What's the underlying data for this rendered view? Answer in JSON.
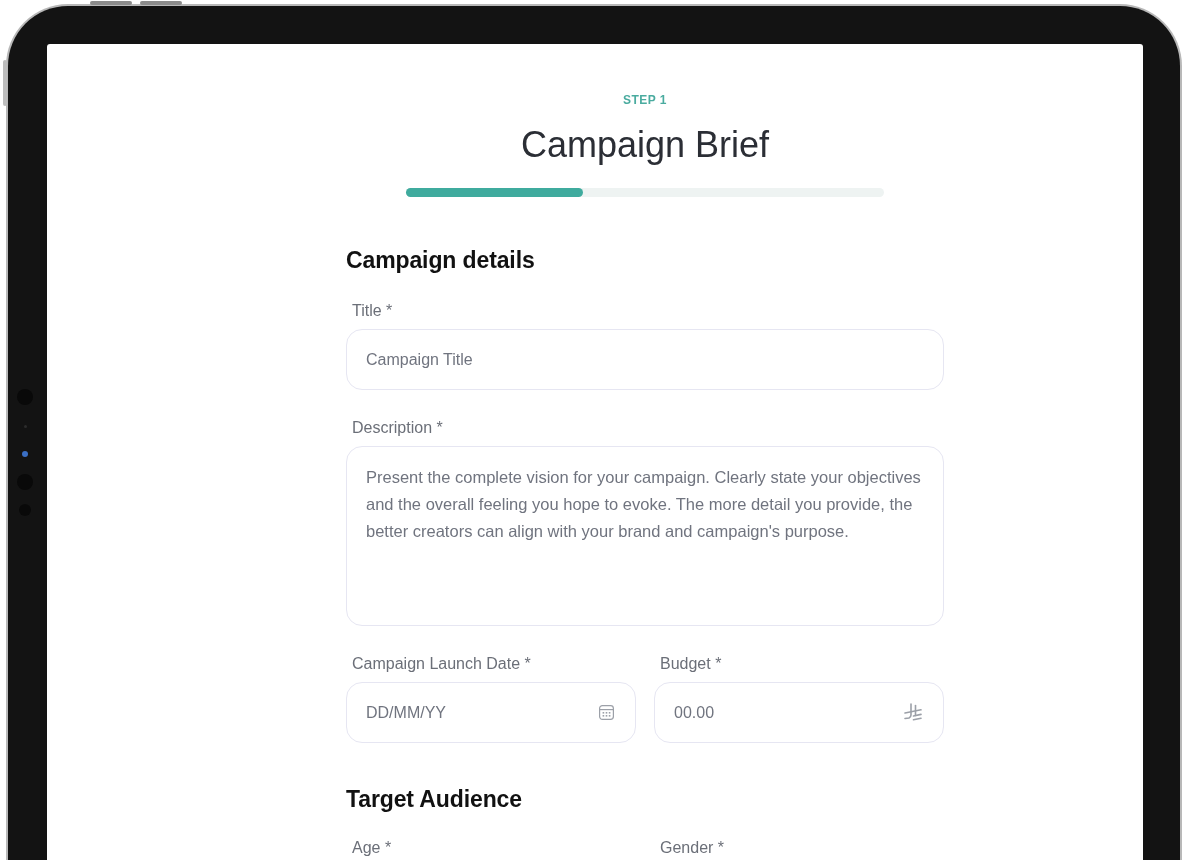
{
  "header": {
    "step": "STEP 1",
    "title": "Campaign Brief",
    "progress": {
      "level": 0.37
    }
  },
  "sections": [
    {
      "heading": "Campaign details",
      "rows": [
        [
          {
            "kind": "text",
            "label": "Title *",
            "placeholder": "Campaign Title"
          }
        ],
        [
          {
            "kind": "textarea",
            "label": "Description *",
            "placeholder": "Present the complete vision for your campaign. Clearly state your objectives and the overall feeling you hope to evoke. The more detail you provide, the better creators can align with your brand and campaign's purpose."
          }
        ],
        [
          {
            "kind": "date",
            "label": "Campaign Launch Date *",
            "placeholder": "DD/MM/YY"
          },
          {
            "kind": "amount",
            "label": "Budget *",
            "placeholder": "00.00"
          }
        ]
      ]
    },
    {
      "heading": "Target Audience",
      "rows": [
        [
          {
            "label": "Age *"
          },
          {
            "label": "Gender *"
          }
        ]
      ]
    }
  ]
}
